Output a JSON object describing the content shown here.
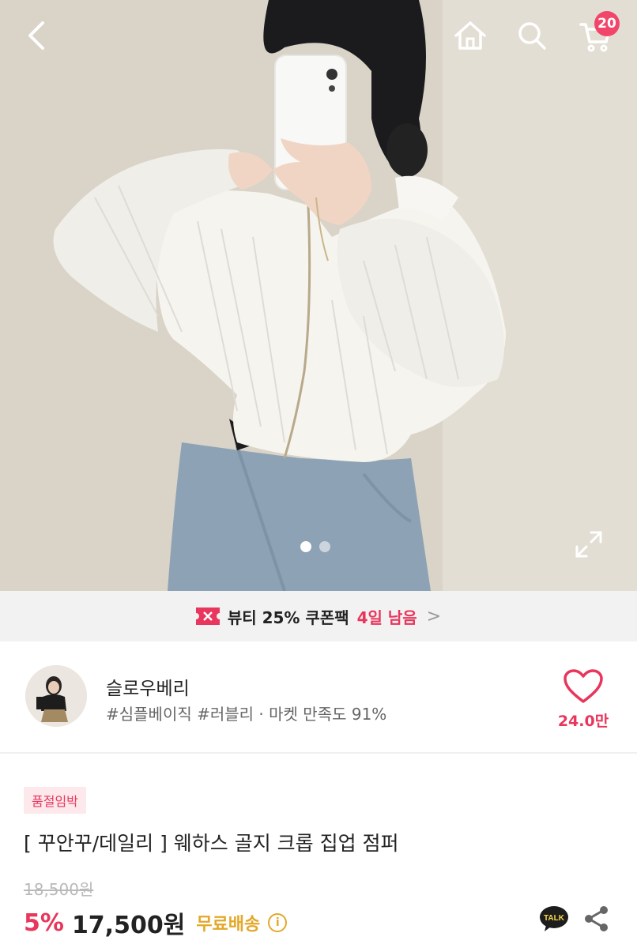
{
  "header": {
    "cart_count": "20",
    "icons": {
      "back": "back-arrow-icon",
      "home": "home-icon",
      "search": "search-icon",
      "cart": "cart-icon"
    }
  },
  "gallery": {
    "total_images": 2,
    "active_index": 0,
    "expand_icon": "expand-icon"
  },
  "coupon": {
    "label": "뷰티 25% 쿠폰팩",
    "days_left": "4일 남음",
    "chevron": ">",
    "accent": "#e8365c"
  },
  "seller": {
    "name": "슬로우베리",
    "tags": "#심플베이직 #러블리 · 마켓 만족도 91%",
    "like_count": "24.0만"
  },
  "product": {
    "badge": "품절임박",
    "title": "[ 꾸안꾸/데일리 ] 웨하스 골지 크롭 집업 점퍼",
    "original_price": "18,500원",
    "discount": "5%",
    "price": "17,500원",
    "shipping": "무료배송",
    "info": "i",
    "talk_label": "TALK"
  },
  "colors": {
    "accent": "#e8365c",
    "shipping": "#e3a829",
    "badge_bg": "#fde8ec"
  }
}
